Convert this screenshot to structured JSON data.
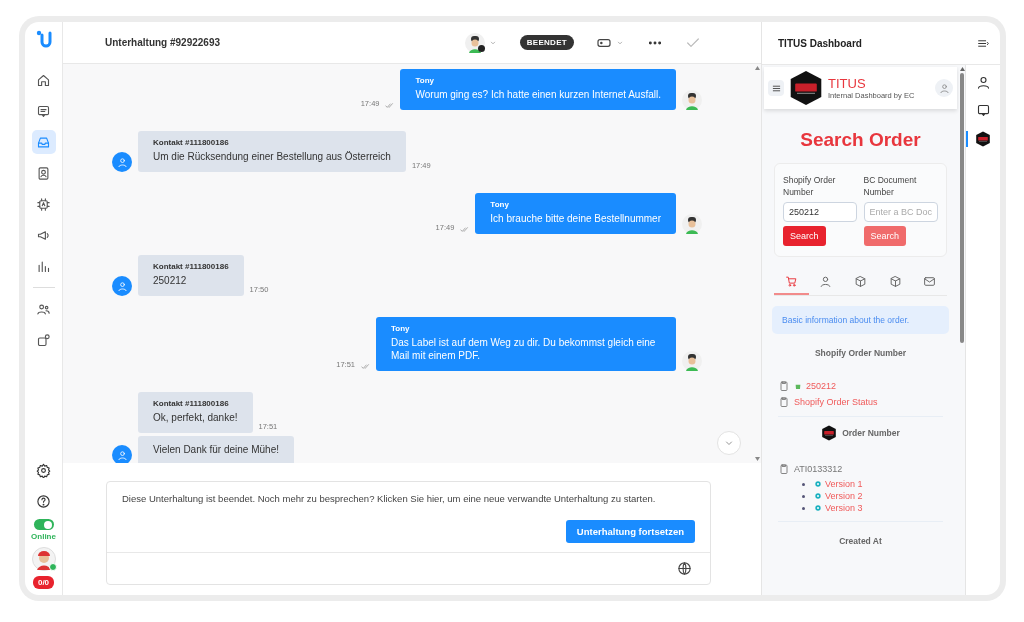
{
  "nav": {
    "items": [
      {
        "selected": false
      },
      {
        "selected": false
      },
      {
        "selected": true
      },
      {
        "selected": false
      },
      {
        "selected": false
      },
      {
        "selected": false
      },
      {
        "selected": false
      },
      {
        "selected": false
      },
      {
        "selected": false
      }
    ],
    "status": {
      "on": true,
      "label": "Online"
    },
    "counter": "0/0"
  },
  "conversation": {
    "title": "Unterhaltung #92922693",
    "status": "BEENDET"
  },
  "messages": [
    {
      "kind": "agent",
      "sender": "Tony",
      "text": "Worum ging es? Ich hatte einen kurzen Internet Ausfall.",
      "time": "17:49"
    },
    {
      "kind": "contact",
      "sender": "Kontakt #111800186",
      "text": "Um die Rücksendung einer Bestellung aus Österreich",
      "time": "17:49"
    },
    {
      "kind": "agent",
      "sender": "Tony",
      "text": "Ich brauche bitte deine Bestellnummer",
      "time": "17:49"
    },
    {
      "kind": "contact",
      "sender": "Kontakt #111800186",
      "text": "250212",
      "time": "17:50"
    },
    {
      "kind": "agent",
      "sender": "Tony",
      "text": "Das Label ist auf dem Weg zu dir. Du bekommst gleich eine Mail mit einem PDF.",
      "time": "17:51"
    },
    {
      "kind": "contact",
      "sender": "Kontakt #111800186",
      "text": "Ok, perfekt, danke!",
      "time": "17:51"
    },
    {
      "kind": "contact",
      "text": "Vielen Dank für deine Mühe!"
    }
  ],
  "composer": {
    "notice": "Diese Unterhaltung ist beendet. Noch mehr zu besprechen? Klicken Sie hier, um eine neue verwandte Unterhaltung zu starten.",
    "button": "Unterhaltung fortsetzen"
  },
  "panel": {
    "title": "TITUS Dashboard",
    "brand": "TITUS",
    "subtitle": "Internal Dashboard by EC",
    "heading": "Search Order",
    "search": [
      {
        "label": "Shopify Order Number",
        "value": "250212",
        "button": "Search",
        "disabled": false
      },
      {
        "label": "BC Document Number",
        "placeholder": "Enter a BC Doc",
        "button": "Search",
        "disabled": true
      }
    ],
    "tabs": [
      {
        "selected": true
      },
      {
        "selected": false
      },
      {
        "selected": false
      },
      {
        "selected": false
      },
      {
        "selected": false
      }
    ],
    "info": "Basic information about the order.",
    "shopify": {
      "heading": "Shopify Order Number",
      "order": "250212",
      "status": "Shopify Order Status"
    },
    "order": {
      "heading": "Order Number",
      "number": "ATI0133312",
      "versions": [
        "Version 1",
        "Version 2",
        "Version 3"
      ]
    },
    "created": "Created At"
  },
  "rail": {
    "items": [
      {
        "selected": false
      },
      {
        "selected": false
      },
      {
        "selected": true
      }
    ]
  }
}
